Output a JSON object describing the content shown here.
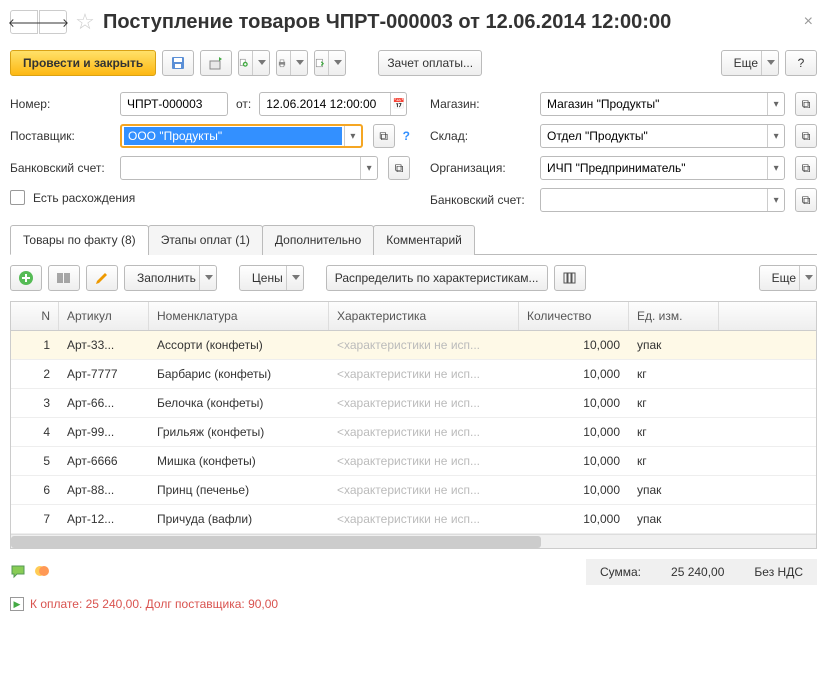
{
  "header": {
    "title": "Поступление товаров ЧПРТ-000003 от 12.06.2014 12:00:00"
  },
  "toolbar": {
    "post_and_close": "Провести и закрыть",
    "offset_payment": "Зачет оплаты...",
    "more": "Еще"
  },
  "form": {
    "number_label": "Номер:",
    "number": "ЧПРТ-000003",
    "date_label": "от:",
    "date": "12.06.2014 12:00:00",
    "supplier_label": "Поставщик:",
    "supplier": "ООО \"Продукты\"",
    "bank_account_label": "Банковский счет:",
    "bank_account_l": "",
    "store_label": "Магазин:",
    "store": "Магазин \"Продукты\"",
    "warehouse_label": "Склад:",
    "warehouse": "Отдел \"Продукты\"",
    "org_label": "Организация:",
    "org": "ИЧП \"Предприниматель\"",
    "bank_account_r_label": "Банковский счет:",
    "bank_account_r": "",
    "discrepancy_label": "Есть расхождения"
  },
  "tabs": {
    "items": [
      "Товары по факту (8)",
      "Этапы оплат (1)",
      "Дополнительно",
      "Комментарий"
    ]
  },
  "tab_toolbar": {
    "fill": "Заполнить",
    "prices": "Цены",
    "distribute": "Распределить по характеристикам...",
    "more": "Еще"
  },
  "grid": {
    "headers": {
      "n": "N",
      "art": "Артикул",
      "nom": "Номенклатура",
      "char": "Характеристика",
      "qty": "Количество",
      "unit": "Ед. изм."
    },
    "rows": [
      {
        "n": "1",
        "art": "Арт-33...",
        "nom": "Ассорти (конфеты)",
        "char": "<характеристики не исп...",
        "qty": "10,000",
        "unit": "упак"
      },
      {
        "n": "2",
        "art": "Арт-7777",
        "nom": "Барбарис (конфеты)",
        "char": "<характеристики не исп...",
        "qty": "10,000",
        "unit": "кг"
      },
      {
        "n": "3",
        "art": "Арт-66...",
        "nom": "Белочка (конфеты)",
        "char": "<характеристики не исп...",
        "qty": "10,000",
        "unit": "кг"
      },
      {
        "n": "4",
        "art": "Арт-99...",
        "nom": "Грильяж (конфеты)",
        "char": "<характеристики не исп...",
        "qty": "10,000",
        "unit": "кг"
      },
      {
        "n": "5",
        "art": "Арт-6666",
        "nom": "Мишка (конфеты)",
        "char": "<характеристики не исп...",
        "qty": "10,000",
        "unit": "кг"
      },
      {
        "n": "6",
        "art": "Арт-88...",
        "nom": "Принц (печенье)",
        "char": "<характеристики не исп...",
        "qty": "10,000",
        "unit": "упак"
      },
      {
        "n": "7",
        "art": "Арт-12...",
        "nom": "Причуда (вафли)",
        "char": "<характеристики не исп...",
        "qty": "10,000",
        "unit": "упак"
      }
    ]
  },
  "footer": {
    "sum_label": "Сумма:",
    "sum": "25 240,00",
    "vat": "Без НДС",
    "status": "К оплате: 25 240,00. Долг поставщика: 90,00"
  }
}
